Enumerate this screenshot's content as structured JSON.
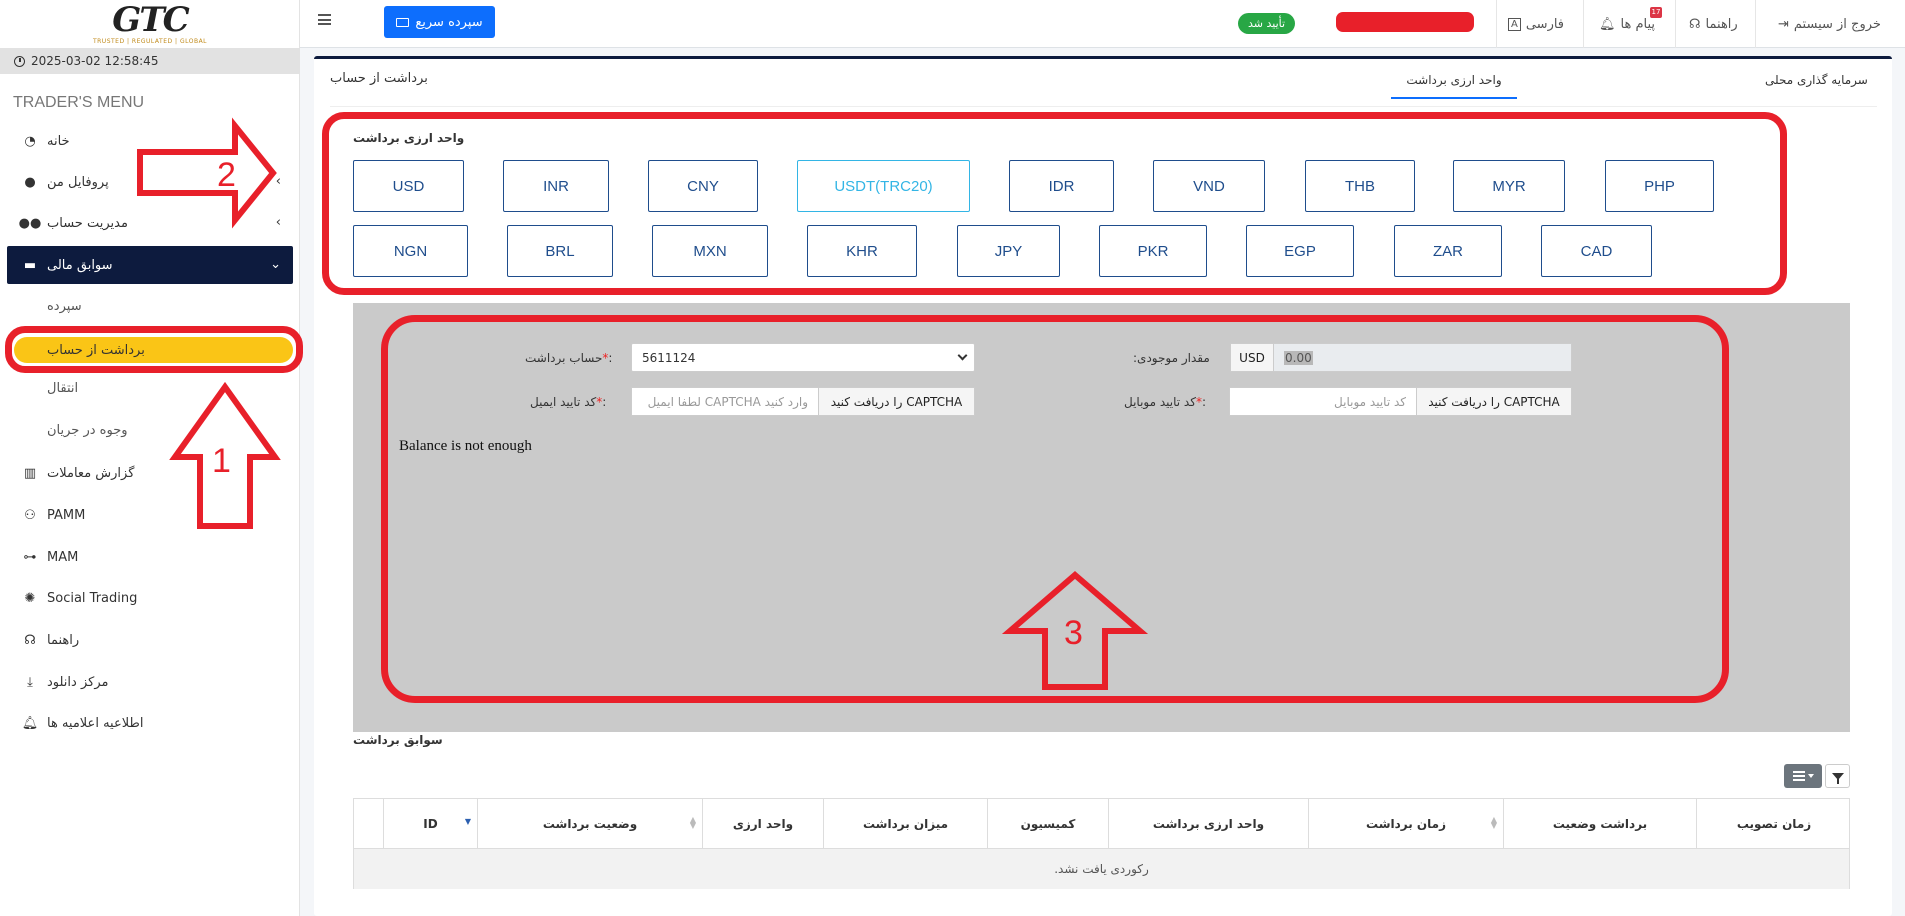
{
  "sidebar": {
    "logo_text": "GTC",
    "logo_tagline": "TRUSTED | REGULATED | GLOBAL",
    "datetime": "2025-03-02 12:58:45",
    "menu_title": "TRADER'S MENU",
    "items": [
      {
        "label": "خانه",
        "icon": "dashboard-icon"
      },
      {
        "label": "پروفایل من",
        "icon": "user-icon"
      },
      {
        "label": "مدیریت حساب",
        "icon": "users-icon"
      },
      {
        "label": "سوابق مالی",
        "icon": "wallet-icon"
      },
      {
        "label": "گزارش معاملات",
        "icon": "chart-icon"
      },
      {
        "label": "PAMM",
        "icon": "pamm-icon"
      },
      {
        "label": "MAM",
        "icon": "mam-icon"
      },
      {
        "label": "Social Trading",
        "icon": "social-icon"
      },
      {
        "label": "راهنما",
        "icon": "headset-icon"
      },
      {
        "label": "مرکز دانلود",
        "icon": "download-icon"
      },
      {
        "label": "اطلاعیه اعلامیه ها",
        "icon": "bell-icon"
      }
    ],
    "sub_items": [
      "سپرده",
      "برداشت از حساب",
      "انتقال",
      "وجوه در جریان"
    ]
  },
  "topbar": {
    "quick_deposit": "سپرده سریع",
    "verified": "تأیید شد",
    "language": "فارسی",
    "messages": "پیام ها",
    "messages_count": "17",
    "help": "راهنما",
    "logout": "خروج از سیستم"
  },
  "page": {
    "title": "برداشت از حساب",
    "tabs": [
      "سرمایه گذاری محلی",
      "واحد ارزی برداشت"
    ]
  },
  "currency": {
    "label": "واحد ارزی برداشت",
    "row1": [
      "USD",
      "INR",
      "CNY",
      "USDT(TRC20)",
      "IDR",
      "VND",
      "THB",
      "MYR",
      "PHP"
    ],
    "row2": [
      "NGN",
      "BRL",
      "MXN",
      "KHR",
      "JPY",
      "PKR",
      "EGP",
      "ZAR",
      "CAD"
    ],
    "selected": "USDT(TRC20)"
  },
  "form": {
    "account_label": "حساب برداشت",
    "account_value": "5611124",
    "balance_label": "مقدار موجودی",
    "balance_currency": "USD",
    "balance_value": "0.00",
    "email_label": "کد تایید ایمیل",
    "email_placeholder": "وارد کنید CAPTCHA لطفا ایمیل",
    "email_btn": "را دریافت کنید CAPTCHA",
    "mobile_label": "کد تایید موبایل",
    "mobile_placeholder": "کد تایید موبایل",
    "mobile_btn": "را دریافت کنید CAPTCHA",
    "req_mark": "*",
    "colon": ":",
    "message": "Balance is not enough"
  },
  "history": {
    "title": "سوابق برداشت",
    "columns": [
      "ID",
      "وضعیت برداشت",
      "واحد ارزی",
      "میزان برداشت",
      "کمیسیون",
      "واحد ارزی برداشت",
      "زمان برداشت",
      "برداشت وضعیت",
      "زمان تصویب"
    ],
    "empty": ".رکوردی یافت نشد"
  },
  "annotations": [
    "1",
    "2",
    "3"
  ],
  "colors": {
    "accent": "#0d6efd",
    "navy": "#0d1b3e",
    "highlight": "#fac516",
    "annotation": "#e8202a",
    "selected_currency": "#33b5e5"
  }
}
